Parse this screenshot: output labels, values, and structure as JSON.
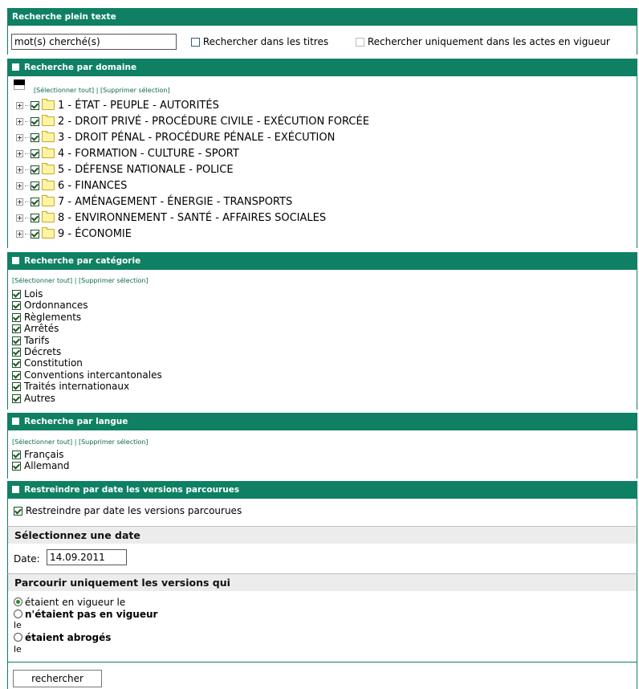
{
  "fulltext": {
    "title": "Recherche plein texte",
    "search_value": "mot(s) cherché(s)",
    "in_titles_label": "Rechercher dans les titres",
    "in_force_label": "Rechercher uniquement dans les actes en vigueur"
  },
  "domain": {
    "title": "Recherche par domaine",
    "select_all": "[Sélectionner tout]",
    "separator": "|",
    "clear": "[Supprimer sélection]",
    "items": [
      "1 - ÉTAT - PEUPLE - AUTORITÉS",
      "2 - DROIT PRIVÉ - PROCÉDURE CIVILE - EXÉCUTION FORCÉE",
      "3 - DROIT PÉNAL - PROCÉDURE PÉNALE - EXÉCUTION",
      "4 - FORMATION - CULTURE - SPORT",
      "5 - DÉFENSE NATIONALE - POLICE",
      "6 - FINANCES",
      "7 - AMÉNAGEMENT - ÉNERGIE - TRANSPORTS",
      "8 - ENVIRONNEMENT - SANTÉ - AFFAIRES SOCIALES",
      "9 - ÉCONOMIE"
    ]
  },
  "category": {
    "title": "Recherche par catégorie",
    "select_all": "[Sélectionner tout]",
    "separator": "|",
    "clear": "[Supprimer sélection]",
    "items": [
      "Lois",
      "Ordonnances",
      "Règlements",
      "Arrêtés",
      "Tarifs",
      "Décrets",
      "Constitution",
      "Conventions intercantonales",
      "Traités internationaux",
      "Autres"
    ]
  },
  "language": {
    "title": "Recherche par langue",
    "select_all": "[Sélectionner tout]",
    "separator": "|",
    "clear": "[Supprimer sélection]",
    "items": [
      "Français",
      "Allemand"
    ]
  },
  "date_restrict": {
    "title": "Restreindre par date les versions parcourues",
    "checkbox_label": "Restreindre par date les versions parcourues",
    "select_date_title": "Sélectionnez une date",
    "date_label": "Date:",
    "date_value": "14.09.2011",
    "versions_title": "Parcourir uniquement les versions qui",
    "option1": "étaient en vigueur le",
    "option2": "n'étaient pas en vigueur",
    "option2_suffix": "le",
    "option3": "étaient abrogés",
    "option3_suffix": "le"
  },
  "search_button": "rechercher",
  "colors": {
    "header_green": "#0f8064",
    "link_green": "#0b6b55",
    "gray_band": "#ececec"
  }
}
